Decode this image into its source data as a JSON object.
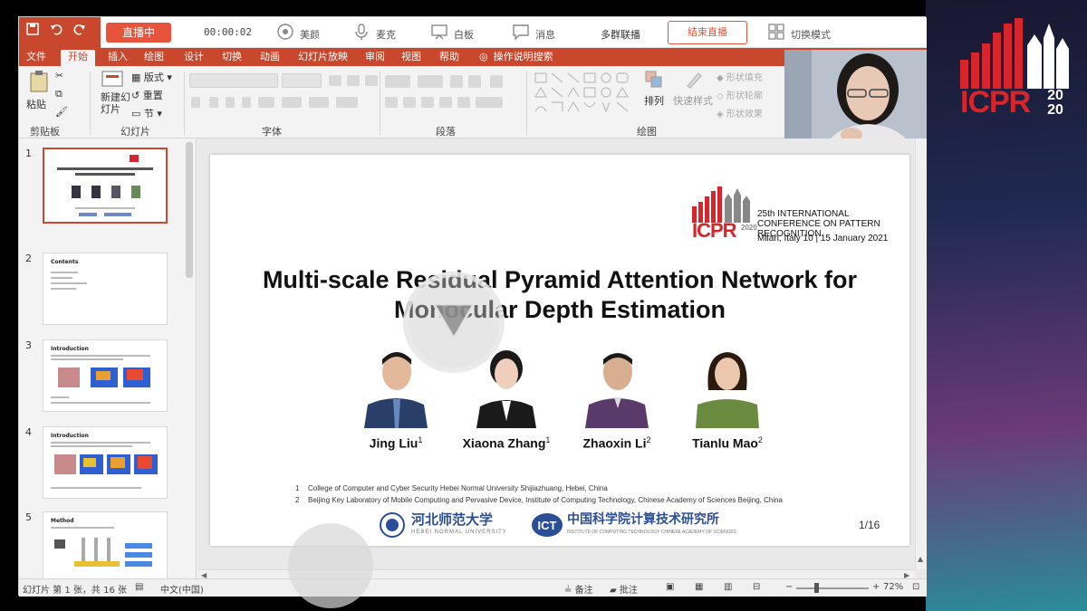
{
  "app": {
    "live_button": "直播中",
    "timer": "00:00:02",
    "tools": {
      "beauty": "美颜",
      "mic": "麦克",
      "whiteboard": "白板",
      "message": "消息"
    },
    "multi_link": "多群联播",
    "end_live": "结束直播",
    "switch_mode": "切换模式"
  },
  "ribbon": {
    "tabs": [
      "文件",
      "开始",
      "插入",
      "绘图",
      "设计",
      "切换",
      "动画",
      "幻灯片放映",
      "审阅",
      "视图",
      "帮助",
      "操作说明搜索"
    ],
    "active_tab": "开始",
    "groups": {
      "clipboard": "剪贴板",
      "slides": "幻灯片",
      "font": "字体",
      "paragraph": "段落",
      "drawing": "绘图"
    },
    "buttons": {
      "paste": "粘贴",
      "new_slide": "新建幻灯片",
      "layout": "版式",
      "reset": "重置",
      "section": "节",
      "arrange": "排列",
      "quick_styles": "快速样式",
      "shape_fill": "形状填充",
      "shape_outline": "形状轮廓",
      "shape_effects": "形状效果"
    }
  },
  "thumbnails": [
    {
      "num": "1",
      "title": "Multi-scale Residual Pyramid Attention Network for Monocular Depth Estimation"
    },
    {
      "num": "2",
      "title": "Contents"
    },
    {
      "num": "3",
      "title": "Introduction"
    },
    {
      "num": "4",
      "title": "Introduction"
    },
    {
      "num": "5",
      "title": "Method"
    }
  ],
  "slide": {
    "conference_name": "25th INTERNATIONAL CONFERENCE ON PATTERN RECOGNITION",
    "conference_venue": "Milan, Italy 10 | 15 January 2021",
    "logo_wordmark": "ICPR",
    "logo_year": "2020",
    "title_line1": "Multi-scale Residual Pyramid Attention Network for",
    "title_line2": "Monocular Depth Estimation",
    "authors": [
      {
        "name": "Jing Liu",
        "sup": "1"
      },
      {
        "name": "Xiaona Zhang",
        "sup": "1"
      },
      {
        "name": "Zhaoxin Li",
        "sup": "2"
      },
      {
        "name": "Tianlu Mao",
        "sup": "2"
      }
    ],
    "affiliations": [
      {
        "num": "1",
        "text": "College of Computer and Cyber Security Hebei Normal University Shijiazhuang, Hebei, China"
      },
      {
        "num": "2",
        "text": "Beijing Key Laboratory of Mobile Computing and Pervasive Device, Institute of Computing Technology, Chinese Academy of Sciences Beijing, China"
      }
    ],
    "uni1_cn": "河北师范大学",
    "uni1_en": "HEBEI NORMAL UNIVERSITY",
    "uni2_cn": "中国科学院计算技术研究所",
    "uni2_en": "INSTITUTE OF COMPUTING TECHNOLOGY CHINESE ACADEMY OF SCIENCES",
    "page": "1/16"
  },
  "status": {
    "slide_info": "幻灯片 第 1 张，共 16 张",
    "language": "中文(中国)",
    "notes": "备注",
    "comments": "批注",
    "zoom": "72%"
  },
  "event_logo": {
    "wordmark": "ICPR",
    "year_top": "20",
    "year_bottom": "20"
  },
  "colors": {
    "ribbon_accent": "#c9472c",
    "icpr_red": "#d8242b",
    "ict_blue": "#2b4f96"
  }
}
